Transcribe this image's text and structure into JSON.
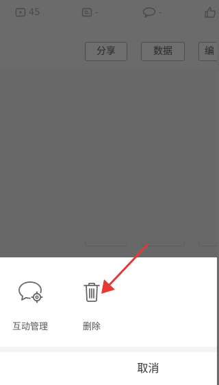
{
  "stats": {
    "views": "45",
    "comments": "-",
    "messages": "-"
  },
  "actions": {
    "share_label": "分享",
    "data_label": "数据",
    "edit_label": "编"
  },
  "sheet": {
    "options": [
      {
        "label": "互动管理",
        "icon": "chat-bubble-gear-icon"
      },
      {
        "label": "删除",
        "icon": "trash-icon"
      }
    ],
    "cancel_label": "取消"
  },
  "colors": {
    "overlay": "#6b6b6b",
    "sheet_bg": "#ffffff",
    "arrow": "#e53935",
    "label_text": "#555555"
  }
}
